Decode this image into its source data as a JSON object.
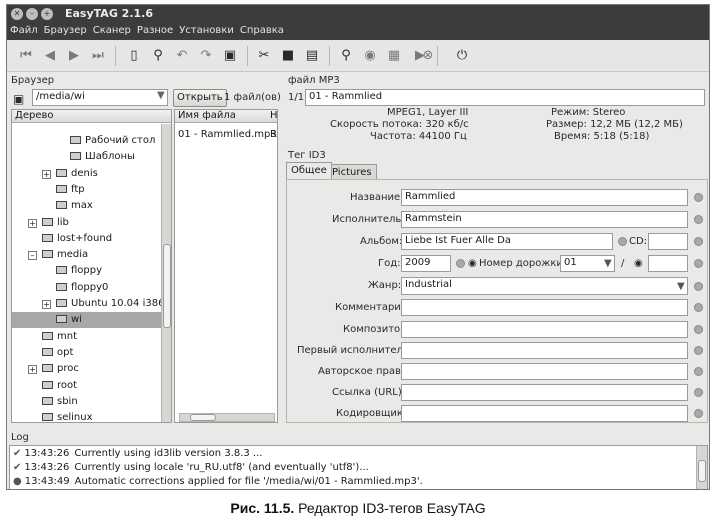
{
  "window": {
    "title": "EasyTAG 2.1.6"
  },
  "menu": [
    "Файл",
    "Браузер",
    "Сканер",
    "Разное",
    "Установки",
    "Справка"
  ],
  "browser": {
    "section_label": "Браузер",
    "path": "/media/wi",
    "open_button": "Открыть",
    "file_count": "1 файл(ов)",
    "tree_header": "Дерево",
    "tree": [
      {
        "label": "Рабочий стол",
        "depth": 2,
        "expander": ""
      },
      {
        "label": "Шаблоны",
        "depth": 2,
        "expander": ""
      },
      {
        "label": "denis",
        "depth": 1,
        "expander": "+"
      },
      {
        "label": "ftp",
        "depth": 1,
        "expander": ""
      },
      {
        "label": "max",
        "depth": 1,
        "expander": ""
      },
      {
        "label": "lib",
        "depth": 0,
        "expander": "+"
      },
      {
        "label": "lost+found",
        "depth": 0,
        "expander": ""
      },
      {
        "label": "media",
        "depth": 0,
        "expander": "–"
      },
      {
        "label": "floppy",
        "depth": 1,
        "expander": ""
      },
      {
        "label": "floppy0",
        "depth": 1,
        "expander": ""
      },
      {
        "label": "Ubuntu 10.04 i386",
        "depth": 1,
        "expander": "+"
      },
      {
        "label": "wi",
        "depth": 1,
        "expander": "",
        "selected": true
      },
      {
        "label": "mnt",
        "depth": 0,
        "expander": ""
      },
      {
        "label": "opt",
        "depth": 0,
        "expander": ""
      },
      {
        "label": "proc",
        "depth": 0,
        "expander": "+"
      },
      {
        "label": "root",
        "depth": 0,
        "expander": ""
      },
      {
        "label": "sbin",
        "depth": 0,
        "expander": ""
      },
      {
        "label": "selinux",
        "depth": 0,
        "expander": ""
      }
    ],
    "files_header": "Имя файла",
    "files_header2": "Н",
    "files": [
      "01 - Rammlied.mp3"
    ],
    "files_col2": "R"
  },
  "mp3": {
    "section_label": "файл MP3",
    "index": "1/1:",
    "filename": "01 - Rammlied",
    "format": "MPEG1, Layer III",
    "bitrate": "Скорость потока: 320 кб/с",
    "frequency": "Частота: 44100 Гц",
    "mode": "Режим: Stereo",
    "size": "Размер: 12,2 МБ (12,2 МБ)",
    "time": "Время: 5:18 (5:18)"
  },
  "tag": {
    "section_label": "Тег ID3",
    "tabs": [
      "Общее",
      "Pictures"
    ],
    "title_label": "Название:",
    "title": "Rammlied",
    "artist_label": "Исполнитель:",
    "artist": "Rammstein",
    "album_label": "Альбом:",
    "album": "Liebe Ist Fuer Alle Da",
    "cd_label": "CD:",
    "cd": "",
    "year_label": "Год:",
    "year": "2009",
    "track_label": "Номер дорожки:",
    "track": "01",
    "track_sep": "/",
    "track_total": "",
    "genre_label": "Жанр:",
    "genre": "Industrial",
    "comment_label": "Комментарий:",
    "comment": "",
    "composer_label": "Композитор:",
    "composer": "",
    "orig_artist_label": "Первый исполнитель:",
    "orig_artist": "",
    "copyright_label": "Авторское право:",
    "copyright": "",
    "url_label": "Ссылка (URL):",
    "url": "",
    "encoder_label": "Кодировщик:",
    "encoder": ""
  },
  "log": {
    "section_label": "Log",
    "entries": [
      {
        "time": "13:43:26",
        "text": "Currently using id3lib version 3.8.3 ..."
      },
      {
        "time": "13:43:26",
        "text": "Currently using locale 'ru_RU.utf8' (and eventually 'utf8')..."
      },
      {
        "time": "13:43:49",
        "text": "Automatic corrections applied for file '/media/wi/01 - Rammlied.mp3'."
      }
    ]
  },
  "caption": {
    "prefix": "Рис. 11.5.",
    "text": "Редактор ID3-тегов EasyTAG"
  }
}
